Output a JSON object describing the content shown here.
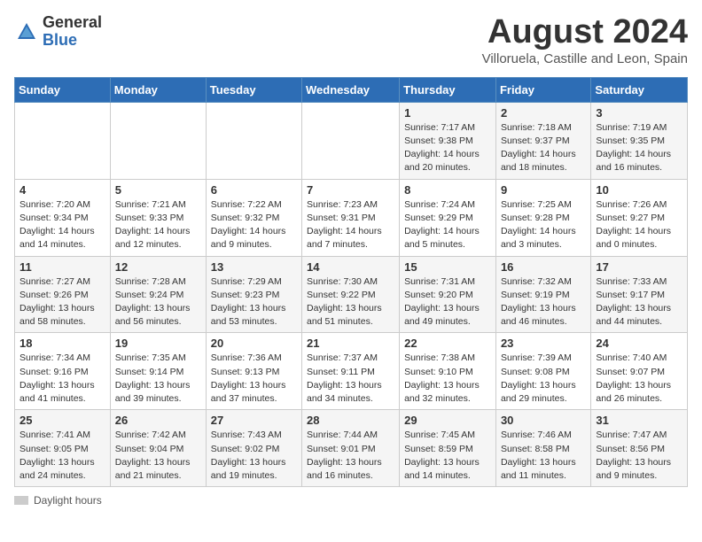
{
  "header": {
    "logo_general": "General",
    "logo_blue": "Blue",
    "title": "August 2024",
    "subtitle": "Villoruela, Castille and Leon, Spain"
  },
  "days_of_week": [
    "Sunday",
    "Monday",
    "Tuesday",
    "Wednesday",
    "Thursday",
    "Friday",
    "Saturday"
  ],
  "weeks": [
    [
      {
        "day": "",
        "info": ""
      },
      {
        "day": "",
        "info": ""
      },
      {
        "day": "",
        "info": ""
      },
      {
        "day": "",
        "info": ""
      },
      {
        "day": "1",
        "info": "Sunrise: 7:17 AM\nSunset: 9:38 PM\nDaylight: 14 hours and 20 minutes."
      },
      {
        "day": "2",
        "info": "Sunrise: 7:18 AM\nSunset: 9:37 PM\nDaylight: 14 hours and 18 minutes."
      },
      {
        "day": "3",
        "info": "Sunrise: 7:19 AM\nSunset: 9:35 PM\nDaylight: 14 hours and 16 minutes."
      }
    ],
    [
      {
        "day": "4",
        "info": "Sunrise: 7:20 AM\nSunset: 9:34 PM\nDaylight: 14 hours and 14 minutes."
      },
      {
        "day": "5",
        "info": "Sunrise: 7:21 AM\nSunset: 9:33 PM\nDaylight: 14 hours and 12 minutes."
      },
      {
        "day": "6",
        "info": "Sunrise: 7:22 AM\nSunset: 9:32 PM\nDaylight: 14 hours and 9 minutes."
      },
      {
        "day": "7",
        "info": "Sunrise: 7:23 AM\nSunset: 9:31 PM\nDaylight: 14 hours and 7 minutes."
      },
      {
        "day": "8",
        "info": "Sunrise: 7:24 AM\nSunset: 9:29 PM\nDaylight: 14 hours and 5 minutes."
      },
      {
        "day": "9",
        "info": "Sunrise: 7:25 AM\nSunset: 9:28 PM\nDaylight: 14 hours and 3 minutes."
      },
      {
        "day": "10",
        "info": "Sunrise: 7:26 AM\nSunset: 9:27 PM\nDaylight: 14 hours and 0 minutes."
      }
    ],
    [
      {
        "day": "11",
        "info": "Sunrise: 7:27 AM\nSunset: 9:26 PM\nDaylight: 13 hours and 58 minutes."
      },
      {
        "day": "12",
        "info": "Sunrise: 7:28 AM\nSunset: 9:24 PM\nDaylight: 13 hours and 56 minutes."
      },
      {
        "day": "13",
        "info": "Sunrise: 7:29 AM\nSunset: 9:23 PM\nDaylight: 13 hours and 53 minutes."
      },
      {
        "day": "14",
        "info": "Sunrise: 7:30 AM\nSunset: 9:22 PM\nDaylight: 13 hours and 51 minutes."
      },
      {
        "day": "15",
        "info": "Sunrise: 7:31 AM\nSunset: 9:20 PM\nDaylight: 13 hours and 49 minutes."
      },
      {
        "day": "16",
        "info": "Sunrise: 7:32 AM\nSunset: 9:19 PM\nDaylight: 13 hours and 46 minutes."
      },
      {
        "day": "17",
        "info": "Sunrise: 7:33 AM\nSunset: 9:17 PM\nDaylight: 13 hours and 44 minutes."
      }
    ],
    [
      {
        "day": "18",
        "info": "Sunrise: 7:34 AM\nSunset: 9:16 PM\nDaylight: 13 hours and 41 minutes."
      },
      {
        "day": "19",
        "info": "Sunrise: 7:35 AM\nSunset: 9:14 PM\nDaylight: 13 hours and 39 minutes."
      },
      {
        "day": "20",
        "info": "Sunrise: 7:36 AM\nSunset: 9:13 PM\nDaylight: 13 hours and 37 minutes."
      },
      {
        "day": "21",
        "info": "Sunrise: 7:37 AM\nSunset: 9:11 PM\nDaylight: 13 hours and 34 minutes."
      },
      {
        "day": "22",
        "info": "Sunrise: 7:38 AM\nSunset: 9:10 PM\nDaylight: 13 hours and 32 minutes."
      },
      {
        "day": "23",
        "info": "Sunrise: 7:39 AM\nSunset: 9:08 PM\nDaylight: 13 hours and 29 minutes."
      },
      {
        "day": "24",
        "info": "Sunrise: 7:40 AM\nSunset: 9:07 PM\nDaylight: 13 hours and 26 minutes."
      }
    ],
    [
      {
        "day": "25",
        "info": "Sunrise: 7:41 AM\nSunset: 9:05 PM\nDaylight: 13 hours and 24 minutes."
      },
      {
        "day": "26",
        "info": "Sunrise: 7:42 AM\nSunset: 9:04 PM\nDaylight: 13 hours and 21 minutes."
      },
      {
        "day": "27",
        "info": "Sunrise: 7:43 AM\nSunset: 9:02 PM\nDaylight: 13 hours and 19 minutes."
      },
      {
        "day": "28",
        "info": "Sunrise: 7:44 AM\nSunset: 9:01 PM\nDaylight: 13 hours and 16 minutes."
      },
      {
        "day": "29",
        "info": "Sunrise: 7:45 AM\nSunset: 8:59 PM\nDaylight: 13 hours and 14 minutes."
      },
      {
        "day": "30",
        "info": "Sunrise: 7:46 AM\nSunset: 8:58 PM\nDaylight: 13 hours and 11 minutes."
      },
      {
        "day": "31",
        "info": "Sunrise: 7:47 AM\nSunset: 8:56 PM\nDaylight: 13 hours and 9 minutes."
      }
    ]
  ],
  "footer": {
    "daylight_label": "Daylight hours"
  }
}
